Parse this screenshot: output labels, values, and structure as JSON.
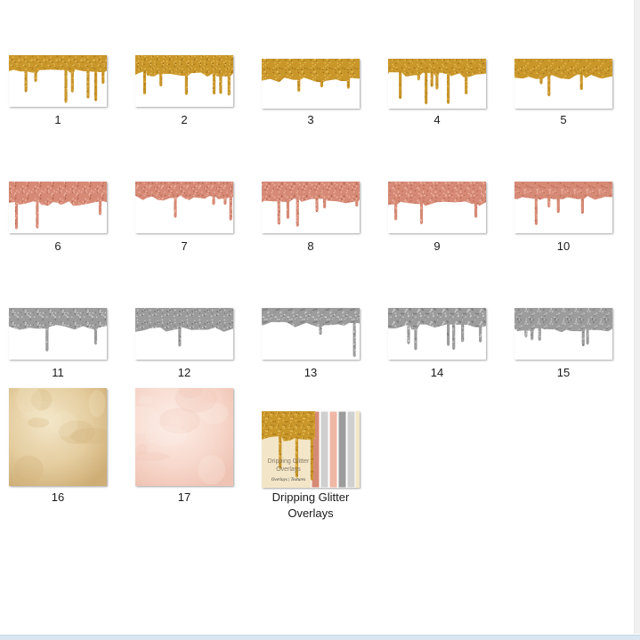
{
  "explorer": {
    "items": [
      {
        "name": "1",
        "kind": "drip",
        "color": "gold"
      },
      {
        "name": "2",
        "kind": "drip",
        "color": "gold"
      },
      {
        "name": "3",
        "kind": "drip",
        "color": "gold"
      },
      {
        "name": "4",
        "kind": "drip",
        "color": "gold"
      },
      {
        "name": "5",
        "kind": "drip",
        "color": "gold"
      },
      {
        "name": "6",
        "kind": "drip",
        "color": "rose"
      },
      {
        "name": "7",
        "kind": "drip",
        "color": "rose"
      },
      {
        "name": "8",
        "kind": "drip",
        "color": "rose"
      },
      {
        "name": "9",
        "kind": "drip",
        "color": "rose"
      },
      {
        "name": "10",
        "kind": "drip",
        "color": "rose"
      },
      {
        "name": "11",
        "kind": "drip",
        "color": "silver"
      },
      {
        "name": "12",
        "kind": "drip",
        "color": "silver"
      },
      {
        "name": "13",
        "kind": "drip",
        "color": "silver"
      },
      {
        "name": "14",
        "kind": "drip",
        "color": "silver"
      },
      {
        "name": "15",
        "kind": "drip",
        "color": "silver"
      },
      {
        "name": "16",
        "kind": "paper",
        "color": "beige"
      },
      {
        "name": "17",
        "kind": "paper",
        "color": "blush"
      },
      {
        "name": "Dripping Glitter\nOverlays",
        "kind": "cover",
        "color": "gold"
      }
    ],
    "cover_art": {
      "line1": "Dripping Glitter",
      "line2": "Overlays",
      "script": "Overlays | Textures"
    },
    "palette": {
      "gold": {
        "base": "#c9962a",
        "light": "#e8c05a",
        "dark": "#9e7118"
      },
      "rose": {
        "base": "#d68a76",
        "light": "#efb7a6",
        "dark": "#b46752"
      },
      "silver": {
        "base": "#9c9c9c",
        "light": "#cfcfcf",
        "dark": "#707070"
      },
      "beige": {
        "base": "#e4cc9e",
        "light": "#f3e6c8",
        "dark": "#cfae76"
      },
      "blush": {
        "base": "#f7d8cc",
        "light": "#fdeee8",
        "dark": "#efc3b3"
      }
    }
  }
}
